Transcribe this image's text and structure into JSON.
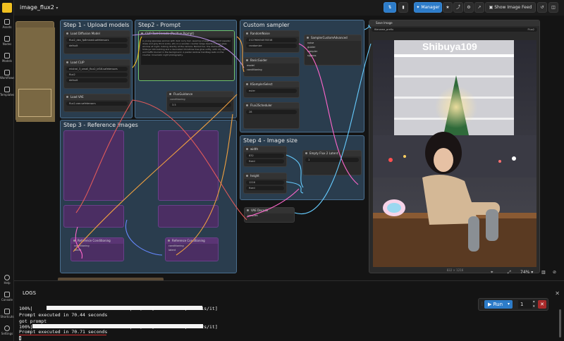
{
  "app": {
    "workflow_tab": "image_flux2",
    "manager_label": "Manager",
    "image_feed_label": "Show Image Feed"
  },
  "sidebar": {
    "items": [
      "Assets",
      "Nodes",
      "Models",
      "Workflows",
      "Templates"
    ],
    "bottom_items": [
      "Help",
      "Console",
      "Shortcuts",
      "Settings"
    ]
  },
  "groups": {
    "step1": "Step 1 - Upload models",
    "step2": "Step2 - Prompt",
    "step3": "Step 3 - Reference images",
    "step4": "Step 4 - Image size",
    "sampler": "Custom sampler"
  },
  "nodes": {
    "load_diffusion": {
      "title": "Load Diffusion Model",
      "w1": "flux2_dev_fp8mixed.safetensors",
      "w2": "default",
      "out": "MODEL"
    },
    "load_clip": {
      "title": "Load CLIP",
      "w1": "mistral_3_small_flux2_bf16.safetensors",
      "w2": "flux2",
      "w3": "default",
      "out": "CLIP"
    },
    "load_vae": {
      "title": "Load VAE",
      "w1": "flux2-vae.safetensors",
      "out": "VAE"
    },
    "clip_text": {
      "title": "CLIP Text Encode (Positive Prompt)",
      "out": "CONDITIONING",
      "text": "A young Japanese woman with dark curly hair, wearing a beige ribbed knit sweater dress and grey thick socks, sits on a wooden counter ledge beside a large glass window at night, looking directly at the camera. Behind her, the illuminated Shibuya 109 building and a decorated Christmas tree glow softly, with city lights and traffic blurred in the background. A pastel rainbow handbag rests on the counter. Cinematic night photography."
    },
    "flux_guidance": {
      "title": "FluxGuidance",
      "w1": "3.5",
      "in": "conditioning",
      "out": "CONDITIONING"
    },
    "random_noise": {
      "title": "RandomNoise",
      "w1": "212760634578316",
      "w2": "randomize",
      "out": "NOISE"
    },
    "basic_guider": {
      "title": "BasicGuider",
      "in1": "model",
      "in2": "conditioning",
      "out": "GUIDER"
    },
    "ksampler_select": {
      "title": "KSamplerSelect",
      "w1": "euler",
      "out": "SAMPLER"
    },
    "flux2_scheduler": {
      "title": "Flux2Scheduler",
      "w1": "28",
      "out": "SIGMAS"
    },
    "sampler_custom": {
      "title": "SamplerCustomAdvanced",
      "in": [
        "noise",
        "guider",
        "sampler",
        "sigmas",
        "latent_image"
      ],
      "out1": "output",
      "out2": "denoised_output"
    },
    "width": {
      "title": "width",
      "w1": "832",
      "w2": "fixed"
    },
    "height": {
      "title": "height",
      "w1": "1216",
      "w2": "fixed"
    },
    "empty_latent": {
      "title": "Empty Flux 2 Latent",
      "w1": "1",
      "out": "LATENT"
    },
    "vae_decode": {
      "title": "VAE Decode",
      "in1": "samples",
      "in2": "vae",
      "out": "IMAGE"
    },
    "save_image": {
      "title": "Save Image",
      "w1": "filename_prefix",
      "w2": "Flux2"
    },
    "ref_node": {
      "title": "Reference Conditioning",
      "in": "conditioning",
      "in2": "latent",
      "out": "CONDITIONING"
    }
  },
  "photo": {
    "sign_text": "Shibuya109",
    "caption": "832 × 1216"
  },
  "canvas_controls": {
    "zoom": "74%"
  },
  "bottom": {
    "tab": "LOGS",
    "run_label": "Run",
    "batch_count": "1",
    "logs": [
      "100%|                                   | 20/20 [01:08<00:00,  3.41s/it]",
      "Prompt executed in 70.44 seconds",
      "got prompt",
      "100%|                                   | 20/20 [01:08<00:00,  3.42s/it]",
      "Prompt executed in 70.71 seconds"
    ]
  },
  "colors": {
    "accent": "#2d7cc9",
    "group": "#3c5f7d",
    "purple_node": "#4b2e63",
    "highlight_underline": "#d63030"
  }
}
